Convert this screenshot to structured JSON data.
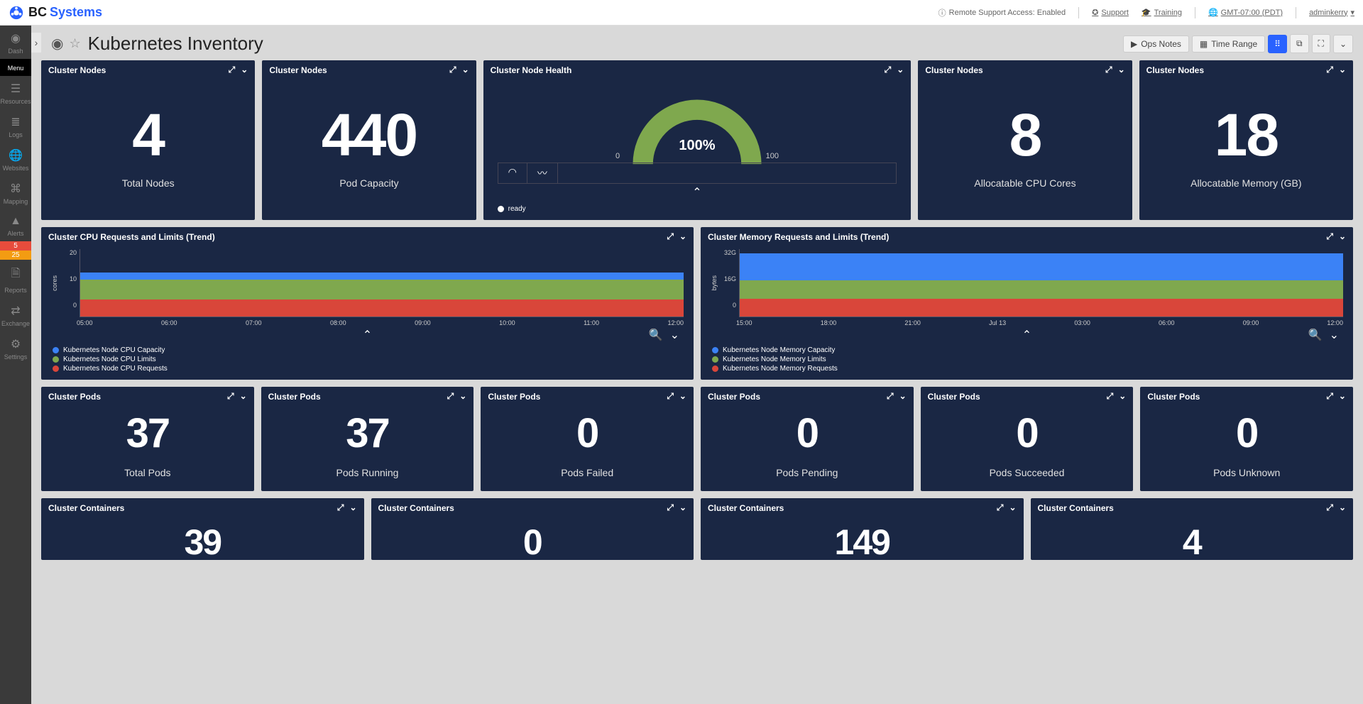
{
  "header": {
    "brand_bc": "BC",
    "brand_systems": "Systems",
    "remote_support": "Remote Support Access: Enabled",
    "support": "Support",
    "training": "Training",
    "timezone": "GMT-07:00 (PDT)",
    "user": "adminkerry"
  },
  "sidebar": {
    "items": [
      {
        "label": "Dash"
      },
      {
        "label": "Menu"
      },
      {
        "label": "Resources"
      },
      {
        "label": "Logs"
      },
      {
        "label": "Websites"
      },
      {
        "label": "Mapping"
      },
      {
        "label": "Alerts"
      },
      {
        "label": "Reports"
      },
      {
        "label": "Exchange"
      },
      {
        "label": "Settings"
      }
    ],
    "alert_badges": {
      "red": "5",
      "orange": "25"
    }
  },
  "page": {
    "title": "Kubernetes Inventory",
    "toolbar": {
      "ops_notes": "Ops Notes",
      "time_range": "Time Range"
    }
  },
  "row1": {
    "nodes_total": {
      "title": "Cluster Nodes",
      "value": "4",
      "label": "Total Nodes"
    },
    "pod_capacity": {
      "title": "Cluster Nodes",
      "value": "440",
      "label": "Pod Capacity"
    },
    "node_health": {
      "title": "Cluster Node Health",
      "value_pct": "100%",
      "min": "0",
      "max": "100",
      "legend": "ready"
    },
    "cpu_cores": {
      "title": "Cluster Nodes",
      "value": "8",
      "label": "Allocatable CPU Cores"
    },
    "memory_gb": {
      "title": "Cluster Nodes",
      "value": "18",
      "label": "Allocatable Memory (GB)"
    }
  },
  "row2": {
    "cpu_trend": {
      "title": "Cluster CPU Requests and Limits (Trend)",
      "y_label": "cores",
      "legend": [
        {
          "name": "Kubernetes Node CPU Capacity",
          "color": "#3b82f6"
        },
        {
          "name": "Kubernetes Node CPU Limits",
          "color": "#7fa84e"
        },
        {
          "name": "Kubernetes Node CPU Requests",
          "color": "#d9463a"
        }
      ]
    },
    "mem_trend": {
      "title": "Cluster Memory Requests and Limits (Trend)",
      "y_label": "bytes",
      "legend": [
        {
          "name": "Kubernetes Node Memory Capacity",
          "color": "#3b82f6"
        },
        {
          "name": "Kubernetes Node Memory Limits",
          "color": "#7fa84e"
        },
        {
          "name": "Kubernetes Node Memory Requests",
          "color": "#d9463a"
        }
      ]
    }
  },
  "row3": {
    "p0": {
      "title": "Cluster Pods",
      "value": "37",
      "label": "Total Pods"
    },
    "p1": {
      "title": "Cluster Pods",
      "value": "37",
      "label": "Pods Running"
    },
    "p2": {
      "title": "Cluster Pods",
      "value": "0",
      "label": "Pods Failed"
    },
    "p3": {
      "title": "Cluster Pods",
      "value": "0",
      "label": "Pods Pending"
    },
    "p4": {
      "title": "Cluster Pods",
      "value": "0",
      "label": "Pods Succeeded"
    },
    "p5": {
      "title": "Cluster Pods",
      "value": "0",
      "label": "Pods Unknown"
    }
  },
  "row4": {
    "c0": {
      "title": "Cluster Containers",
      "value": "39"
    },
    "c1": {
      "title": "Cluster Containers",
      "value": "0"
    },
    "c2": {
      "title": "Cluster Containers",
      "value": "149"
    },
    "c3": {
      "title": "Cluster Containers",
      "value": "4"
    }
  },
  "chart_data": [
    {
      "type": "area",
      "title": "Cluster CPU Requests and Limits (Trend)",
      "xlabel": "",
      "ylabel": "cores",
      "ylim": [
        0,
        20
      ],
      "x": [
        "05:00",
        "06:00",
        "07:00",
        "08:00",
        "09:00",
        "10:00",
        "11:00",
        "12:00"
      ],
      "series": [
        {
          "name": "Kubernetes Node CPU Capacity",
          "values": [
            13,
            13,
            13,
            13,
            13,
            13,
            13,
            13
          ]
        },
        {
          "name": "Kubernetes Node CPU Limits",
          "values": [
            11,
            11,
            11,
            11,
            11,
            11,
            11,
            11
          ]
        },
        {
          "name": "Kubernetes Node CPU Requests",
          "values": [
            5,
            5,
            5,
            5,
            5,
            5,
            5,
            5
          ]
        }
      ]
    },
    {
      "type": "area",
      "title": "Cluster Memory Requests and Limits (Trend)",
      "xlabel": "",
      "ylabel": "bytes",
      "ylim": [
        0,
        32
      ],
      "y_ticks": [
        "0",
        "16G",
        "32G"
      ],
      "x": [
        "15:00",
        "18:00",
        "21:00",
        "Jul 13",
        "03:00",
        "06:00",
        "09:00",
        "12:00"
      ],
      "series": [
        {
          "name": "Kubernetes Node Memory Capacity",
          "values": [
            30,
            30,
            30,
            30,
            30,
            30,
            30,
            30
          ]
        },
        {
          "name": "Kubernetes Node Memory Limits",
          "values": [
            17,
            17,
            17,
            17,
            17,
            17,
            17,
            17
          ]
        },
        {
          "name": "Kubernetes Node Memory Requests",
          "values": [
            8,
            8,
            8,
            8,
            8,
            8,
            8,
            8
          ]
        }
      ]
    }
  ]
}
